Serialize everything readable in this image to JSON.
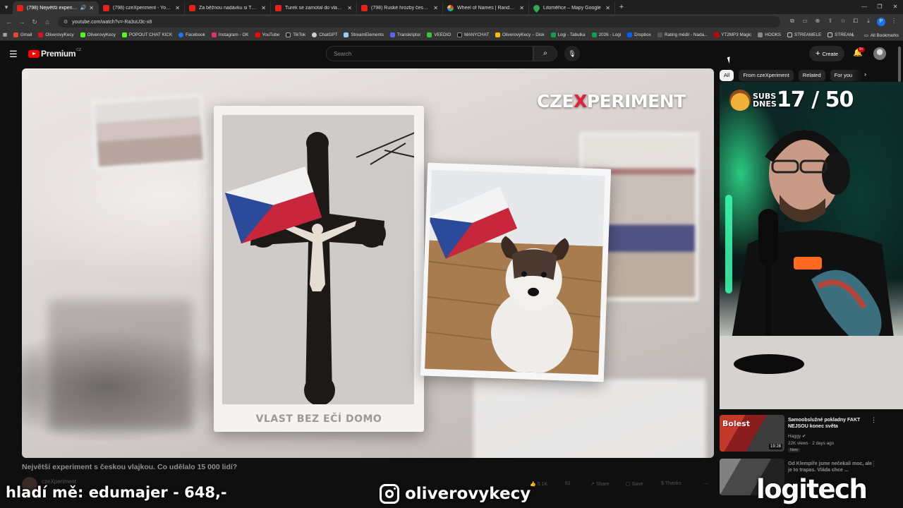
{
  "browser": {
    "tabs": [
      {
        "title": "(798) Největší experiment s",
        "active": true,
        "favicon": "youtube"
      },
      {
        "title": "(798) czeXperiment - YouTube",
        "active": false,
        "favicon": "youtube"
      },
      {
        "title": "Za běžnou nadávku si Turek vy",
        "active": false,
        "favicon": "youtube"
      },
      {
        "title": "Turek se zamotal do vlastních l",
        "active": false,
        "favicon": "youtube"
      },
      {
        "title": "(798) Ruské hrozby českým zbr",
        "active": false,
        "favicon": "youtube"
      },
      {
        "title": "Wheel of Names | Random nam",
        "active": false,
        "favicon": "wheel"
      },
      {
        "title": "Litoměřice – Mapy Google",
        "active": false,
        "favicon": "map"
      }
    ],
    "url": "youtube.com/watch?v=-Ra3uU3c-x8",
    "bookmarks": [
      "Gmail",
      "OliverovyKecy",
      "OliverovyKecy",
      "POPOUT CHAT KICK",
      "Facebook",
      "Instagram - OK",
      "YouTube",
      "TikTok",
      "ChatGPT",
      "StreamElements",
      "Transkriptor",
      "VEEDIO",
      "MANYCHAT",
      "OliverovyKecy – Disk",
      "Logi - Tabulka",
      "2026 - Logi",
      "Dropbox",
      "Rating médií - Nada...",
      "YT2MP3 Magic",
      "HOOKS",
      "STREAMELE",
      "STREAM"
    ],
    "all_bookmarks": "All Bookmarks"
  },
  "masthead": {
    "logo_text": "Premium",
    "country_code": "CZ",
    "search_placeholder": "Search",
    "create_label": "Create",
    "notification_badge": "9+"
  },
  "video": {
    "watermark_pre": "CZE",
    "watermark_x": "X",
    "watermark_post": "PERIMENT",
    "photo_caption": "VLAST BEZ  EČÍ DOMO",
    "title": "Největší experiment s českou vlajkou. Co udělalo 15 000 lidí?",
    "channel": "czeXperiment",
    "likes": "5,1K",
    "views_short": "61",
    "share_label": "Share",
    "save_label": "Save",
    "thanks_label": "Thanks"
  },
  "sidebar": {
    "chips": [
      "All",
      "From czeXperiment",
      "Related",
      "For you"
    ],
    "active_chip": 0,
    "recommendations": [
      {
        "title": "Samoobslužné pokladny FAKT NEJSOU konec světa",
        "channel": "Haggy",
        "meta": "22K views · 2 days ago",
        "badge": "New",
        "duration": "19:28",
        "thumb_text": "Bolest"
      },
      {
        "title": "Od Klempíře jsme nečekali moc, ale je to trapas. Vláda chce ...",
        "channel": "",
        "meta": "",
        "badge": "",
        "duration": "",
        "thumb_text": ""
      }
    ]
  },
  "webcam": {
    "subs_label": "SUBS DNES",
    "subs_count": "17 / 50"
  },
  "overlays": {
    "donation_text": "hladí mě: edumajer - 648,-",
    "instagram_handle": "oliverovykecy",
    "sponsor": "logitech"
  }
}
